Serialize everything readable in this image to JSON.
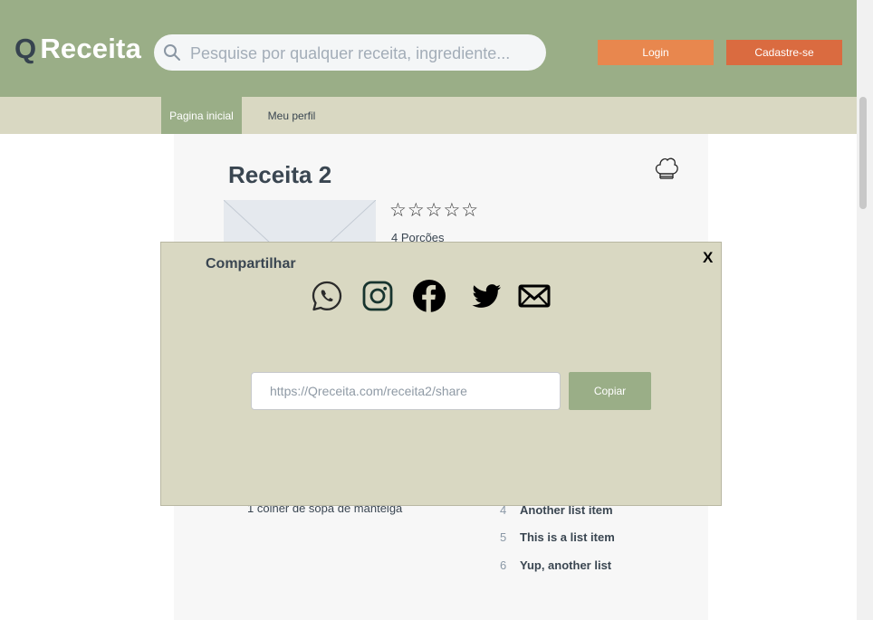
{
  "header": {
    "logo_q": "Q",
    "logo_text": "Receita",
    "search_placeholder": "Pesquise por qualquer receita, ingrediente...",
    "login_label": "Login",
    "signup_label": "Cadastre-se"
  },
  "nav": {
    "tabs": [
      {
        "label": "Pagina inicial",
        "active": true
      },
      {
        "label": "Meu perfil",
        "active": false
      }
    ]
  },
  "recipe": {
    "title": "Receita 2",
    "stars": "☆☆☆☆☆",
    "portions": "4 Porcões",
    "ingredient_visible": "1 colher de sopa de manteiga",
    "steps": [
      {
        "num": "4",
        "text": "Another list item"
      },
      {
        "num": "5",
        "text": "This is a list item"
      },
      {
        "num": "6",
        "text": "Yup, another list"
      }
    ]
  },
  "modal": {
    "title": "Compartilhar",
    "close_label": "X",
    "share_url": "https://Qreceita.com/receita2/share",
    "copy_label": "Copiar",
    "share_icons": [
      "whatsapp-icon",
      "instagram-icon",
      "facebook-icon",
      "twitter-icon",
      "email-icon"
    ]
  },
  "colors": {
    "header": "#9aae87",
    "navbar": "#d9d8c2",
    "login": "#e8874e",
    "signup": "#da6b40",
    "text_dark": "#3a4651"
  }
}
